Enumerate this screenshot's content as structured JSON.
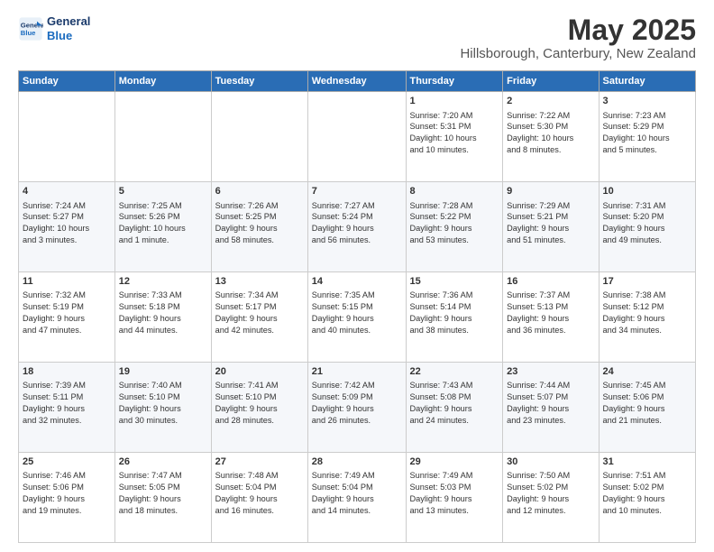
{
  "header": {
    "logo_line1": "General",
    "logo_line2": "Blue",
    "month": "May 2025",
    "location": "Hillsborough, Canterbury, New Zealand"
  },
  "columns": [
    "Sunday",
    "Monday",
    "Tuesday",
    "Wednesday",
    "Thursday",
    "Friday",
    "Saturday"
  ],
  "weeks": [
    [
      {
        "day": "",
        "info": ""
      },
      {
        "day": "",
        "info": ""
      },
      {
        "day": "",
        "info": ""
      },
      {
        "day": "",
        "info": ""
      },
      {
        "day": "1",
        "info": "Sunrise: 7:20 AM\nSunset: 5:31 PM\nDaylight: 10 hours\nand 10 minutes."
      },
      {
        "day": "2",
        "info": "Sunrise: 7:22 AM\nSunset: 5:30 PM\nDaylight: 10 hours\nand 8 minutes."
      },
      {
        "day": "3",
        "info": "Sunrise: 7:23 AM\nSunset: 5:29 PM\nDaylight: 10 hours\nand 5 minutes."
      }
    ],
    [
      {
        "day": "4",
        "info": "Sunrise: 7:24 AM\nSunset: 5:27 PM\nDaylight: 10 hours\nand 3 minutes."
      },
      {
        "day": "5",
        "info": "Sunrise: 7:25 AM\nSunset: 5:26 PM\nDaylight: 10 hours\nand 1 minute."
      },
      {
        "day": "6",
        "info": "Sunrise: 7:26 AM\nSunset: 5:25 PM\nDaylight: 9 hours\nand 58 minutes."
      },
      {
        "day": "7",
        "info": "Sunrise: 7:27 AM\nSunset: 5:24 PM\nDaylight: 9 hours\nand 56 minutes."
      },
      {
        "day": "8",
        "info": "Sunrise: 7:28 AM\nSunset: 5:22 PM\nDaylight: 9 hours\nand 53 minutes."
      },
      {
        "day": "9",
        "info": "Sunrise: 7:29 AM\nSunset: 5:21 PM\nDaylight: 9 hours\nand 51 minutes."
      },
      {
        "day": "10",
        "info": "Sunrise: 7:31 AM\nSunset: 5:20 PM\nDaylight: 9 hours\nand 49 minutes."
      }
    ],
    [
      {
        "day": "11",
        "info": "Sunrise: 7:32 AM\nSunset: 5:19 PM\nDaylight: 9 hours\nand 47 minutes."
      },
      {
        "day": "12",
        "info": "Sunrise: 7:33 AM\nSunset: 5:18 PM\nDaylight: 9 hours\nand 44 minutes."
      },
      {
        "day": "13",
        "info": "Sunrise: 7:34 AM\nSunset: 5:17 PM\nDaylight: 9 hours\nand 42 minutes."
      },
      {
        "day": "14",
        "info": "Sunrise: 7:35 AM\nSunset: 5:15 PM\nDaylight: 9 hours\nand 40 minutes."
      },
      {
        "day": "15",
        "info": "Sunrise: 7:36 AM\nSunset: 5:14 PM\nDaylight: 9 hours\nand 38 minutes."
      },
      {
        "day": "16",
        "info": "Sunrise: 7:37 AM\nSunset: 5:13 PM\nDaylight: 9 hours\nand 36 minutes."
      },
      {
        "day": "17",
        "info": "Sunrise: 7:38 AM\nSunset: 5:12 PM\nDaylight: 9 hours\nand 34 minutes."
      }
    ],
    [
      {
        "day": "18",
        "info": "Sunrise: 7:39 AM\nSunset: 5:11 PM\nDaylight: 9 hours\nand 32 minutes."
      },
      {
        "day": "19",
        "info": "Sunrise: 7:40 AM\nSunset: 5:10 PM\nDaylight: 9 hours\nand 30 minutes."
      },
      {
        "day": "20",
        "info": "Sunrise: 7:41 AM\nSunset: 5:10 PM\nDaylight: 9 hours\nand 28 minutes."
      },
      {
        "day": "21",
        "info": "Sunrise: 7:42 AM\nSunset: 5:09 PM\nDaylight: 9 hours\nand 26 minutes."
      },
      {
        "day": "22",
        "info": "Sunrise: 7:43 AM\nSunset: 5:08 PM\nDaylight: 9 hours\nand 24 minutes."
      },
      {
        "day": "23",
        "info": "Sunrise: 7:44 AM\nSunset: 5:07 PM\nDaylight: 9 hours\nand 23 minutes."
      },
      {
        "day": "24",
        "info": "Sunrise: 7:45 AM\nSunset: 5:06 PM\nDaylight: 9 hours\nand 21 minutes."
      }
    ],
    [
      {
        "day": "25",
        "info": "Sunrise: 7:46 AM\nSunset: 5:06 PM\nDaylight: 9 hours\nand 19 minutes."
      },
      {
        "day": "26",
        "info": "Sunrise: 7:47 AM\nSunset: 5:05 PM\nDaylight: 9 hours\nand 18 minutes."
      },
      {
        "day": "27",
        "info": "Sunrise: 7:48 AM\nSunset: 5:04 PM\nDaylight: 9 hours\nand 16 minutes."
      },
      {
        "day": "28",
        "info": "Sunrise: 7:49 AM\nSunset: 5:04 PM\nDaylight: 9 hours\nand 14 minutes."
      },
      {
        "day": "29",
        "info": "Sunrise: 7:49 AM\nSunset: 5:03 PM\nDaylight: 9 hours\nand 13 minutes."
      },
      {
        "day": "30",
        "info": "Sunrise: 7:50 AM\nSunset: 5:02 PM\nDaylight: 9 hours\nand 12 minutes."
      },
      {
        "day": "31",
        "info": "Sunrise: 7:51 AM\nSunset: 5:02 PM\nDaylight: 9 hours\nand 10 minutes."
      }
    ]
  ]
}
